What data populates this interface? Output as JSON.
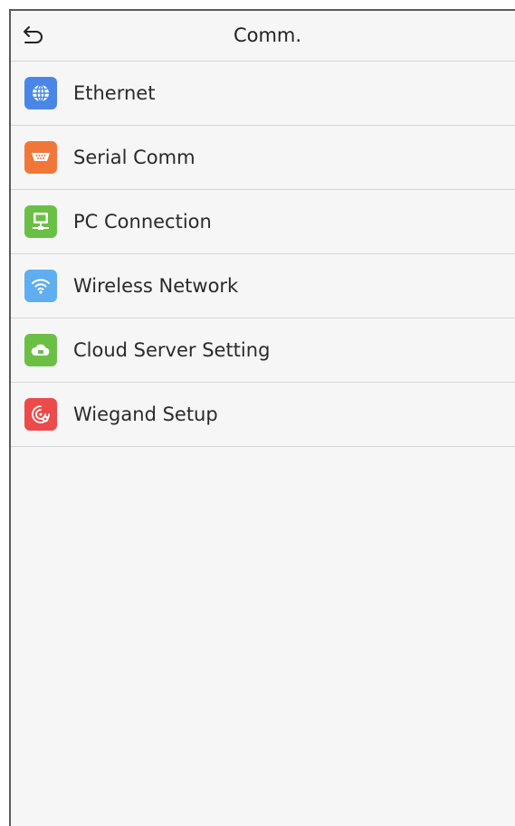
{
  "header": {
    "title": "Comm."
  },
  "menu": {
    "items": [
      {
        "label": "Ethernet",
        "icon": "globe-icon",
        "color": "#4a86e8"
      },
      {
        "label": "Serial Comm",
        "icon": "serial-port-icon",
        "color": "#f0773a"
      },
      {
        "label": "PC Connection",
        "icon": "monitor-icon",
        "color": "#6cbf46"
      },
      {
        "label": "Wireless Network",
        "icon": "wifi-icon",
        "color": "#5eaef0"
      },
      {
        "label": "Cloud Server Setting",
        "icon": "cloud-icon",
        "color": "#6cbf46"
      },
      {
        "label": "Wiegand Setup",
        "icon": "wiegand-icon",
        "color": "#ec4b4b"
      }
    ]
  }
}
